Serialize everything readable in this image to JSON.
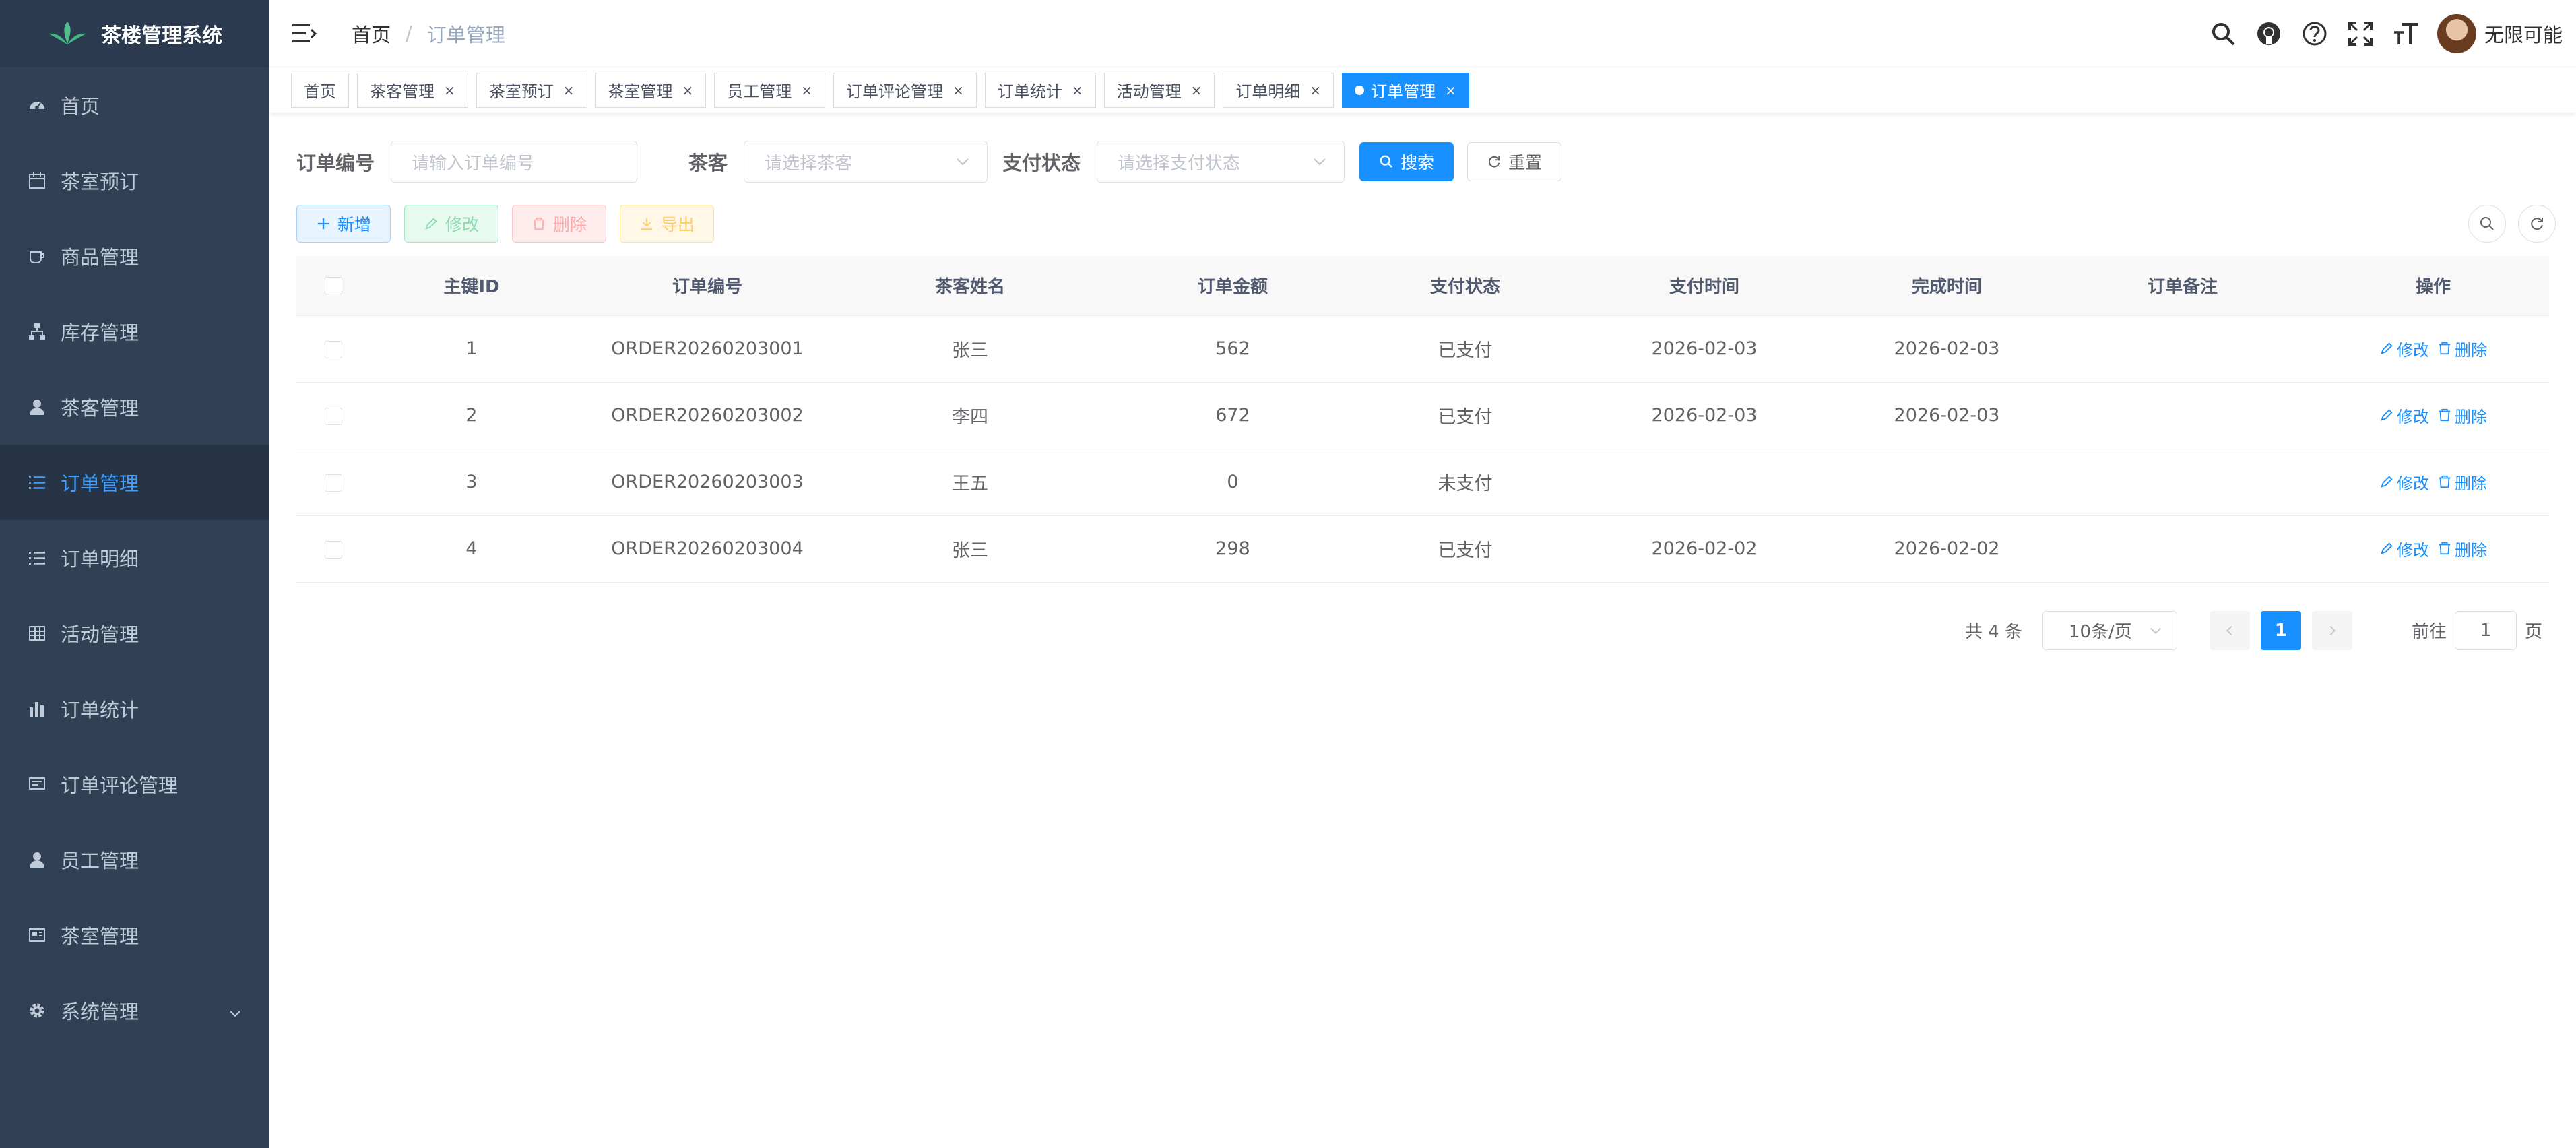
{
  "app": {
    "title": "茶楼管理系统"
  },
  "sidebar": {
    "items": [
      {
        "label": "首页",
        "icon": "dashboard-icon"
      },
      {
        "label": "茶室预订",
        "icon": "calendar-icon"
      },
      {
        "label": "商品管理",
        "icon": "cup-icon"
      },
      {
        "label": "库存管理",
        "icon": "tree-icon"
      },
      {
        "label": "茶客管理",
        "icon": "user-icon"
      },
      {
        "label": "订单管理",
        "icon": "list-icon",
        "active": true
      },
      {
        "label": "订单明细",
        "icon": "list-icon"
      },
      {
        "label": "活动管理",
        "icon": "table-icon"
      },
      {
        "label": "订单统计",
        "icon": "chart-icon"
      },
      {
        "label": "订单评论管理",
        "icon": "comment-icon"
      },
      {
        "label": "员工管理",
        "icon": "user-icon"
      },
      {
        "label": "茶室管理",
        "icon": "room-icon"
      },
      {
        "label": "系统管理",
        "icon": "gear-icon",
        "has_children": true
      }
    ]
  },
  "navbar": {
    "breadcrumb": {
      "home": "首页",
      "separator": "/",
      "current": "订单管理"
    },
    "username": "无限可能"
  },
  "tags": [
    {
      "label": "首页",
      "closable": false
    },
    {
      "label": "茶客管理",
      "closable": true
    },
    {
      "label": "茶室预订",
      "closable": true
    },
    {
      "label": "茶室管理",
      "closable": true
    },
    {
      "label": "员工管理",
      "closable": true
    },
    {
      "label": "订单评论管理",
      "closable": true
    },
    {
      "label": "订单统计",
      "closable": true
    },
    {
      "label": "活动管理",
      "closable": true
    },
    {
      "label": "订单明细",
      "closable": true
    },
    {
      "label": "订单管理",
      "closable": true,
      "active": true
    }
  ],
  "search": {
    "order_no_label": "订单编号",
    "order_no_placeholder": "请输入订单编号",
    "customer_label": "茶客",
    "customer_placeholder": "请选择茶客",
    "pay_status_label": "支付状态",
    "pay_status_placeholder": "请选择支付状态",
    "search_btn": "搜索",
    "reset_btn": "重置"
  },
  "toolbar": {
    "add": "新增",
    "edit": "修改",
    "delete": "删除",
    "export": "导出"
  },
  "table": {
    "columns": [
      "主键ID",
      "订单编号",
      "茶客姓名",
      "订单金额",
      "支付状态",
      "支付时间",
      "完成时间",
      "订单备注",
      "操作"
    ],
    "rows": [
      {
        "id": "1",
        "order_no": "ORDER20260203001",
        "customer": "张三",
        "amount": "562",
        "status": "已支付",
        "pay_time": "2026-02-03",
        "done_time": "2026-02-03",
        "remark": ""
      },
      {
        "id": "2",
        "order_no": "ORDER20260203002",
        "customer": "李四",
        "amount": "672",
        "status": "已支付",
        "pay_time": "2026-02-03",
        "done_time": "2026-02-03",
        "remark": ""
      },
      {
        "id": "3",
        "order_no": "ORDER20260203003",
        "customer": "王五",
        "amount": "0",
        "status": "未支付",
        "pay_time": "",
        "done_time": "",
        "remark": ""
      },
      {
        "id": "4",
        "order_no": "ORDER20260203004",
        "customer": "张三",
        "amount": "298",
        "status": "已支付",
        "pay_time": "2026-02-02",
        "done_time": "2026-02-02",
        "remark": ""
      }
    ],
    "edit_op": "修改",
    "delete_op": "删除"
  },
  "pagination": {
    "total_text": "共 4 条",
    "page_size": "10条/页",
    "current_page": "1",
    "goto_label": "前往",
    "goto_value": "1",
    "page_suffix": "页"
  },
  "colors": {
    "sidebar_bg": "#304156",
    "primary": "#1890ff",
    "menu_text": "#bfcbd9"
  }
}
